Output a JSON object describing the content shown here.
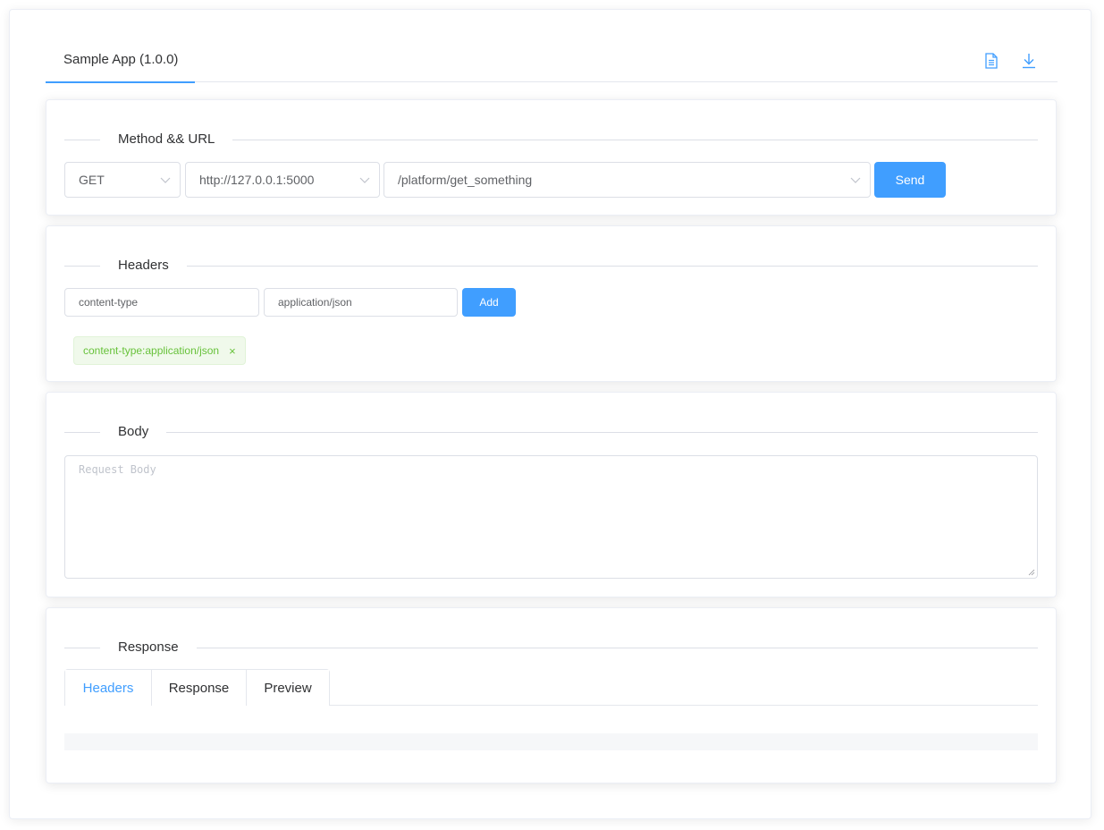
{
  "app_tab": {
    "label": "Sample App (1.0.0)"
  },
  "toolbar": {
    "doc_icon": "document-icon",
    "download_icon": "download-icon"
  },
  "method_url": {
    "section_title": "Method && URL",
    "method": "GET",
    "host": "http://127.0.0.1:5000",
    "path": "/platform/get_something",
    "send_label": "Send"
  },
  "headers": {
    "section_title": "Headers",
    "key_value": "content-type",
    "value_value": "application/json",
    "add_label": "Add",
    "tags": [
      {
        "label": "content-type:application/json"
      }
    ],
    "tag_close": "×"
  },
  "body": {
    "section_title": "Body",
    "placeholder": "Request Body"
  },
  "response": {
    "section_title": "Response",
    "tabs": [
      {
        "label": "Headers"
      },
      {
        "label": "Response"
      },
      {
        "label": "Preview"
      }
    ],
    "active_tab": "Headers"
  },
  "colors": {
    "primary": "#409eff",
    "success": "#67c23a"
  }
}
